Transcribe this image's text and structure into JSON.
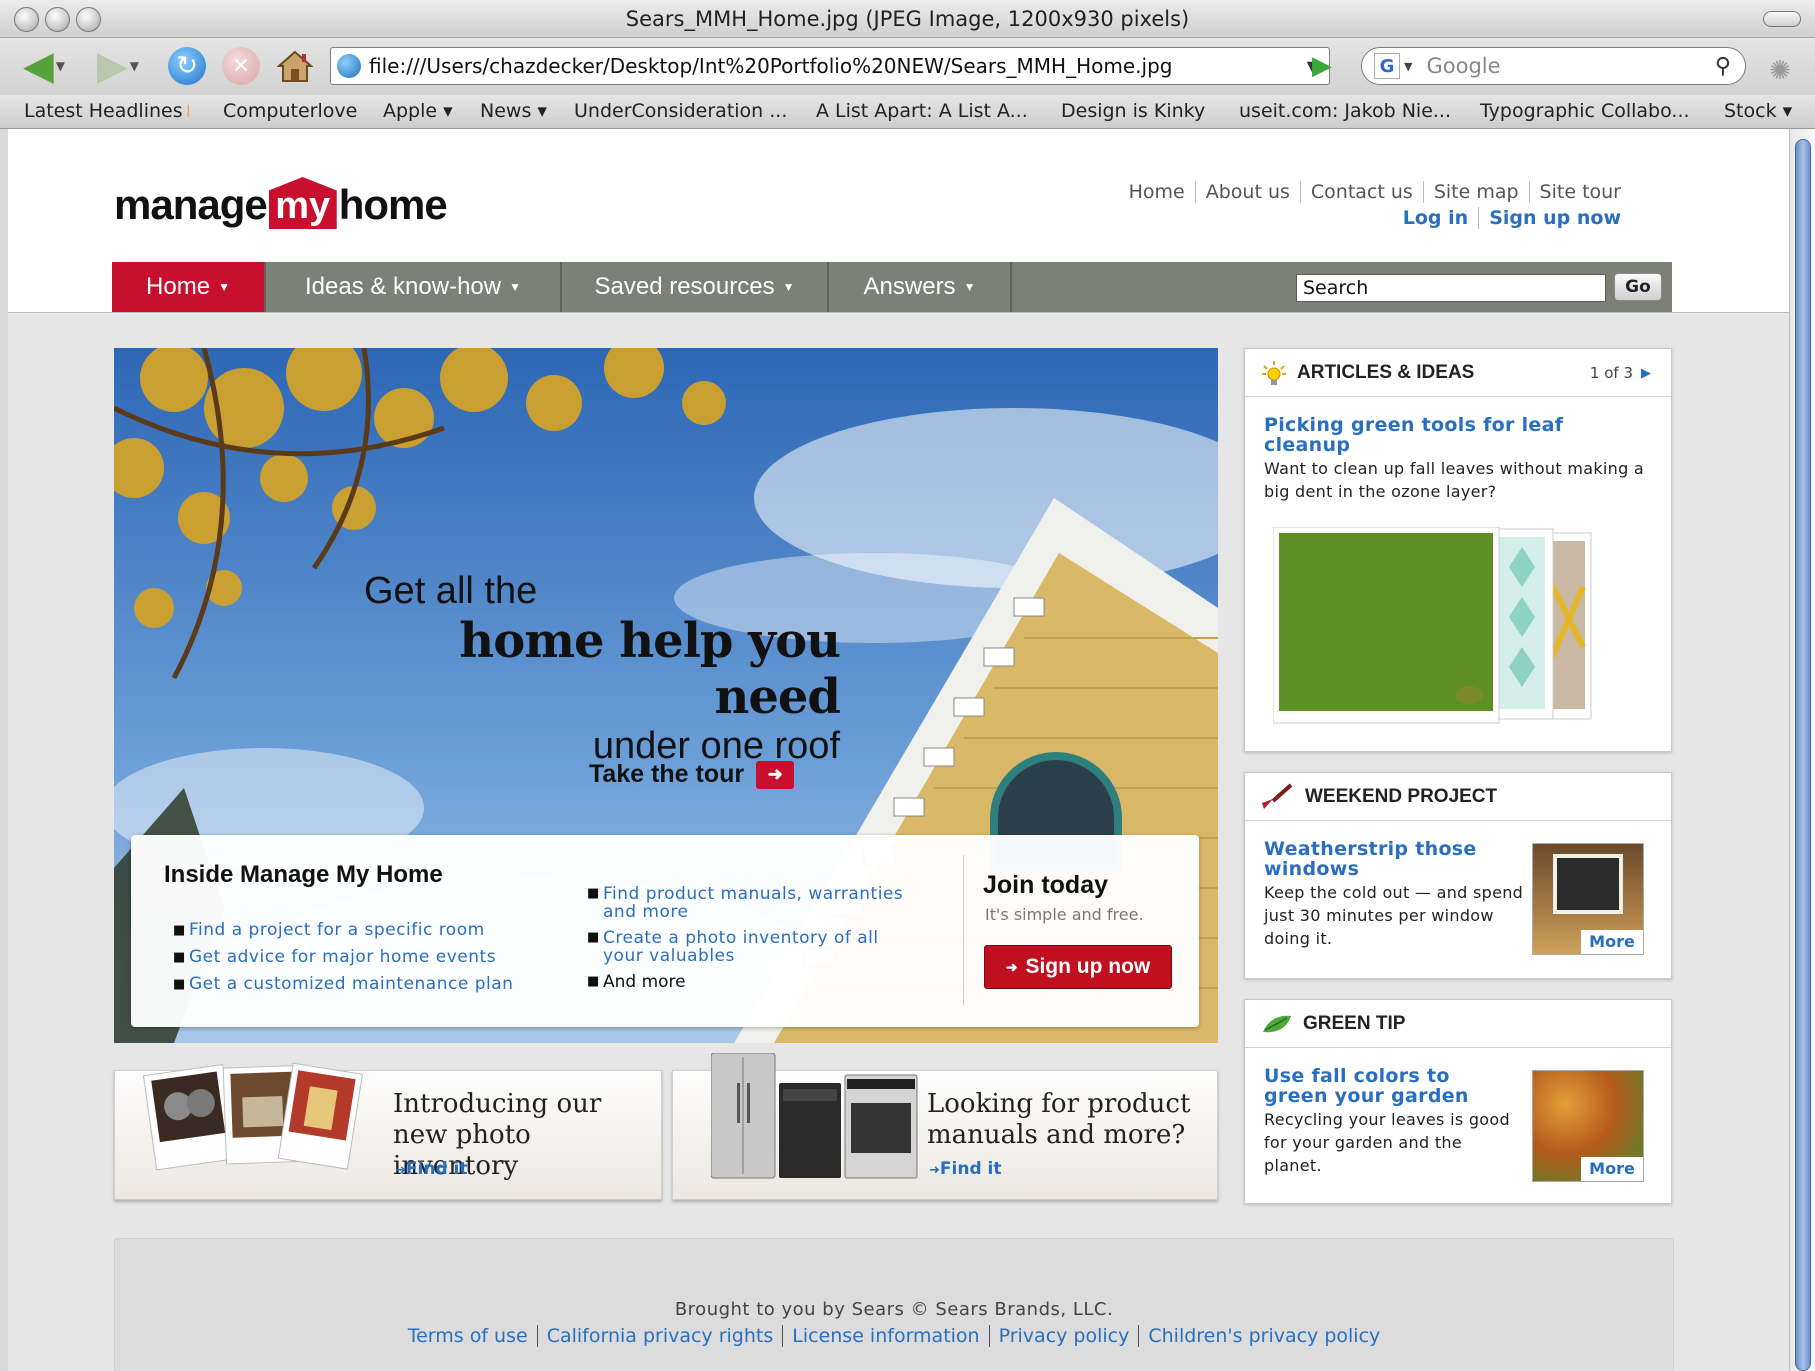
{
  "window": {
    "title": "Sears_MMH_Home.jpg (JPEG Image, 1200x930 pixels)"
  },
  "toolbar": {
    "url": "file:///Users/chazdecker/Desktop/Int%20Portfolio%20NEW/Sears_MMH_Home.jpg",
    "search_placeholder": "Google"
  },
  "bookmarks": [
    "Latest Headlines",
    "Computerlove",
    "Apple ▾",
    "News ▾",
    "UnderConsideration ...",
    "A List Apart: A List A...",
    "Design is Kinky",
    "useit.com: Jakob Nie...",
    "Typographic Collabo...",
    "Stock ▾"
  ],
  "site": {
    "logo": {
      "left": "manage",
      "mid": "my",
      "right": "home"
    },
    "util_links": [
      "Home",
      "About us",
      "Contact us",
      "Site map",
      "Site tour"
    ],
    "auth_links": [
      "Log in",
      "Sign up now"
    ],
    "nav": [
      "Home",
      "Ideas & know-how",
      "Saved resources",
      "Answers"
    ],
    "search_value": "Search",
    "search_go": "Go"
  },
  "hero": {
    "line1": "Get all the",
    "line2": "home help you need",
    "line3": "under one roof",
    "tour": "Take the tour",
    "inside_title": "Inside Manage My Home",
    "list_a": [
      "Find a project for a specific room",
      "Get advice for major home events",
      "Get a customized maintenance plan"
    ],
    "list_b": [
      "Find product manuals, warranties and more",
      "Create a photo inventory of all your valuables",
      "And more"
    ],
    "join_title": "Join today",
    "join_sub": "It's simple and free.",
    "join_button": "Sign up now"
  },
  "promos": {
    "photo": {
      "title": "Introducing our new photo inventory",
      "link": "Find it"
    },
    "manual": {
      "title": "Looking for product manuals and more?",
      "link": "Find it"
    }
  },
  "sidebar": {
    "articles": {
      "title": "ARTICLES & IDEAS",
      "pager": "1 of 3",
      "link": "Picking green tools for leaf cleanup",
      "text": "Want to clean up fall leaves without making a big dent in the ozone layer?"
    },
    "weekend": {
      "title": "WEEKEND PROJECT",
      "link": "Weatherstrip those windows",
      "text": "Keep the cold out — and spend just 30 minutes per window doing it.",
      "more": "More"
    },
    "green": {
      "title": "GREEN TIP",
      "link": "Use fall colors to green your garden",
      "text": "Recycling your leaves is good for your garden and the planet.",
      "more": "More"
    }
  },
  "footer": {
    "line": "Brought to you by Sears © Sears Brands, LLC.",
    "links": [
      "Terms of use",
      "California privacy rights",
      "License information",
      "Privacy policy",
      "Children's privacy policy"
    ]
  }
}
